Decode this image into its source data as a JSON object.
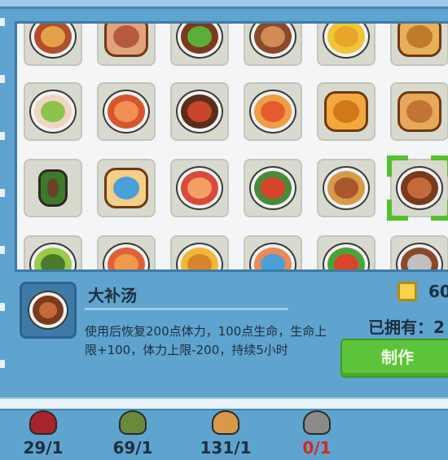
{
  "selected_item": {
    "name": "大补汤",
    "description": "使用后恢复200点体力，100点生命，生命上限+100，体力上限-200，持续5小时",
    "price": "60",
    "owned_label": "已拥有：2",
    "craft_button": "制作"
  },
  "recipes": [
    [
      {
        "icon": "roast-meat-icon",
        "type": "bowl",
        "base": "#b24e2a",
        "top": "#e5a14a"
      },
      {
        "icon": "bacon-icon",
        "type": "bread",
        "base": "#e3a37a",
        "top": "#b75b3f"
      },
      {
        "icon": "stir-fry-icon",
        "type": "bowl",
        "base": "#7a3a1c",
        "top": "#5cae38"
      },
      {
        "icon": "meat-dish-icon",
        "type": "bowl",
        "base": "#8a4a2a",
        "top": "#d08a54"
      },
      {
        "icon": "fried-rice-icon",
        "type": "bowl",
        "base": "#f1c536",
        "top": "#e7a62a"
      },
      {
        "icon": "pancake-stack-icon",
        "type": "bread",
        "base": "#e8b05a",
        "top": "#c07a2c"
      }
    ],
    [
      {
        "icon": "salad-bowl-icon",
        "type": "bowl",
        "base": "#f0d6c2",
        "top": "#8cc44a"
      },
      {
        "icon": "noodle-soup-icon",
        "type": "bowl",
        "base": "#d8562e",
        "top": "#f09055"
      },
      {
        "icon": "braised-pork-icon",
        "type": "bowl",
        "base": "#5a2f1a",
        "top": "#c9442a"
      },
      {
        "icon": "shrimp-dish-icon",
        "type": "bowl",
        "base": "#f19d46",
        "top": "#e65b2e"
      },
      {
        "icon": "bun-icon",
        "type": "bread",
        "base": "#f3a83e",
        "top": "#d17818"
      },
      {
        "icon": "fried-dough-icon",
        "type": "bread",
        "base": "#e8a85a",
        "top": "#c27432"
      }
    ],
    [
      {
        "icon": "pickle-jar-icon",
        "type": "jar",
        "base": "#3c7a2c",
        "top": "#6a4226"
      },
      {
        "icon": "sandwich-icon",
        "type": "bread",
        "base": "#f3cf8a",
        "top": "#4aa0d8"
      },
      {
        "icon": "fruit-bowl-icon",
        "type": "bowl",
        "base": "#d94a3a",
        "top": "#f0a060"
      },
      {
        "icon": "vegetable-soup-icon",
        "type": "bowl",
        "base": "#4a8a3a",
        "top": "#d8442a"
      },
      {
        "icon": "curry-bowl-icon",
        "type": "bowl",
        "base": "#d79a48",
        "top": "#a8582a"
      },
      {
        "icon": "tonic-soup-icon",
        "type": "bowl",
        "base": "#7a3a1c",
        "top": "#c46a3a",
        "selected": true
      }
    ],
    [
      {
        "icon": "green-soup-icon",
        "type": "bowl",
        "base": "#9acb4a",
        "top": "#4a7a2c"
      },
      {
        "icon": "tomato-dish-icon",
        "type": "bowl",
        "base": "#e0603a",
        "top": "#f09a4a"
      },
      {
        "icon": "golden-soup-icon",
        "type": "bowl",
        "base": "#f0b83a",
        "top": "#d9842a"
      },
      {
        "icon": "seafood-soup-icon",
        "type": "bowl",
        "base": "#e88a5a",
        "top": "#4aa0d8"
      },
      {
        "icon": "garden-salad-icon",
        "type": "bowl",
        "base": "#4aa43a",
        "top": "#d9442a"
      },
      {
        "icon": "stew-icon",
        "type": "bowl",
        "base": "#8a4a2a",
        "top": "#c0c0c0"
      }
    ]
  ],
  "inventory": [
    {
      "icon": "mushroom-icon",
      "count": "29/1",
      "color": "#a8242a",
      "enough": true
    },
    {
      "icon": "herb-sprig-icon",
      "count": "69/1",
      "color": "#6a8a3a",
      "enough": true
    },
    {
      "icon": "sausage-icon",
      "count": "131/1",
      "color": "#d89a4a",
      "enough": true
    },
    {
      "icon": "cooking-pot-icon",
      "count": "0/1",
      "color": "#8a8a8a",
      "enough": false
    }
  ]
}
